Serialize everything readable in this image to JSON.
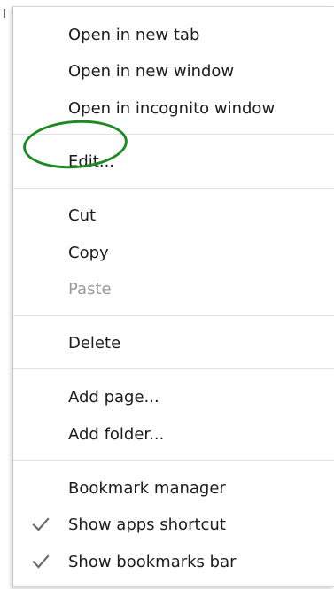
{
  "menu": {
    "groups": [
      {
        "items": [
          {
            "label": "Open in new tab",
            "enabled": true,
            "checked": false
          },
          {
            "label": "Open in new window",
            "enabled": true,
            "checked": false
          },
          {
            "label": "Open in incognito window",
            "enabled": true,
            "checked": false
          }
        ]
      },
      {
        "items": [
          {
            "label": "Edit...",
            "enabled": true,
            "checked": false,
            "highlighted": true
          }
        ]
      },
      {
        "items": [
          {
            "label": "Cut",
            "enabled": true,
            "checked": false
          },
          {
            "label": "Copy",
            "enabled": true,
            "checked": false
          },
          {
            "label": "Paste",
            "enabled": false,
            "checked": false
          }
        ]
      },
      {
        "items": [
          {
            "label": "Delete",
            "enabled": true,
            "checked": false
          }
        ]
      },
      {
        "items": [
          {
            "label": "Add page...",
            "enabled": true,
            "checked": false
          },
          {
            "label": "Add folder...",
            "enabled": true,
            "checked": false
          }
        ]
      },
      {
        "items": [
          {
            "label": "Bookmark manager",
            "enabled": true,
            "checked": false
          },
          {
            "label": "Show apps shortcut",
            "enabled": true,
            "checked": true
          },
          {
            "label": "Show bookmarks bar",
            "enabled": true,
            "checked": true
          }
        ]
      }
    ]
  },
  "colors": {
    "text": "#1c1c1c",
    "disabled_text": "#9b9b9b",
    "separator": "#e1e1e1",
    "highlight_circle": "#1e8a22",
    "checkmark": "#6b6b6b"
  },
  "icons": {
    "check": "check-icon"
  }
}
